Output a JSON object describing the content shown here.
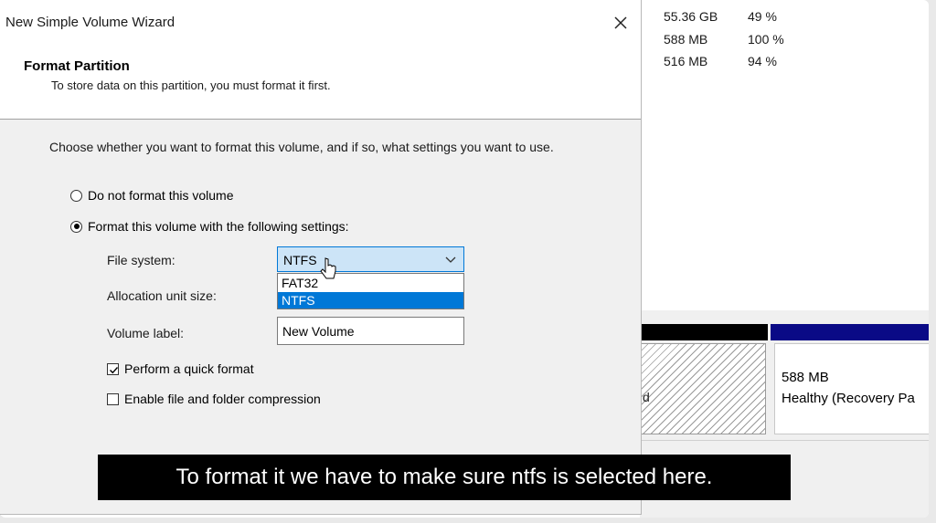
{
  "volume_list": {
    "rows": [
      {
        "capacity": "55.36 GB",
        "free_pct": "49 %"
      },
      {
        "capacity": "588 MB",
        "free_pct": "100 %"
      },
      {
        "capacity": "516 MB",
        "free_pct": "94 %"
      }
    ]
  },
  "disk_map": {
    "hatched_partition_fragment": "d",
    "recovery_partition": {
      "size": "588 MB",
      "status": "Healthy (Recovery Pa"
    }
  },
  "wizard": {
    "title": "New Simple Volume Wizard",
    "close_icon": "close-icon",
    "page_title": "Format Partition",
    "page_subtitle": "To store data on this partition, you must format it first.",
    "instruction": "Choose whether you want to format this volume, and if so, what settings you want to use.",
    "options": {
      "no_format": {
        "label": "Do not format this volume",
        "selected": false
      },
      "format": {
        "label": "Format this volume with the following settings:",
        "selected": true
      }
    },
    "file_system": {
      "label": "File system:",
      "value": "NTFS",
      "dropdown_open": true,
      "options": [
        "FAT32",
        "NTFS"
      ],
      "highlighted": "NTFS"
    },
    "allocation_unit_size": {
      "label": "Allocation unit size:"
    },
    "volume_label": {
      "label": "Volume label:",
      "value": "New Volume"
    },
    "quick_format": {
      "label": "Perform a quick format",
      "checked": true
    },
    "compression": {
      "label": "Enable file and folder compression",
      "checked": false
    }
  },
  "caption": "To format it we have to make sure ntfs is selected here.",
  "colors": {
    "accent": "#0078d7",
    "combo_highlight": "#cce4f7",
    "disk_bar_blue": "#0a0a86"
  }
}
